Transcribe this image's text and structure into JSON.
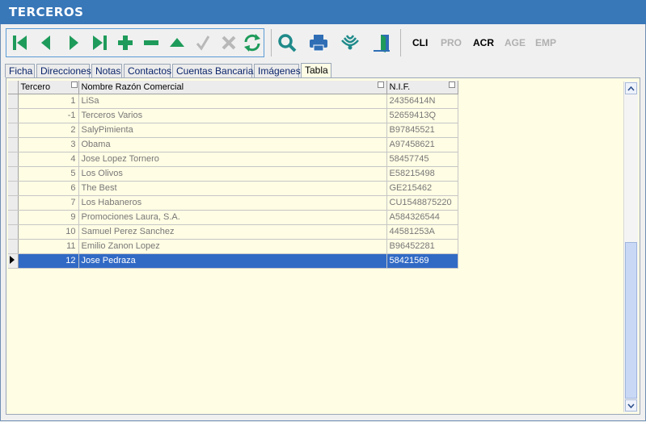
{
  "window": {
    "title": "TERCEROS"
  },
  "toolbar": {
    "nav_icons": [
      "first-record-icon",
      "prev-record-icon",
      "next-record-icon",
      "last-record-icon",
      "add-icon",
      "delete-icon",
      "edit-icon",
      "confirm-icon",
      "cancel-icon",
      "refresh-icon"
    ],
    "tool_icons": [
      "search-icon",
      "print-icon",
      "signal-icon",
      "exit-icon"
    ],
    "text_buttons": [
      {
        "label": "CLI",
        "enabled": true
      },
      {
        "label": "PRO",
        "enabled": false
      },
      {
        "label": "ACR",
        "enabled": true
      },
      {
        "label": "AGE",
        "enabled": false
      },
      {
        "label": "EMP",
        "enabled": false
      }
    ],
    "colors": {
      "nav": "#1e9b5a",
      "disabled": "#b8b8b8",
      "search": "#1f8a8a",
      "print": "#2f6eb5"
    }
  },
  "tabs": [
    {
      "label": "Ficha"
    },
    {
      "label": "Direcciones"
    },
    {
      "label": "Notas"
    },
    {
      "label": "Contactos"
    },
    {
      "label": "Cuentas Bancarias"
    },
    {
      "label": "Imágenes"
    },
    {
      "label": "Tabla",
      "active": true
    }
  ],
  "grid": {
    "columns": [
      "Tercero",
      "Nombre Razón Comercial",
      "N.I.F."
    ],
    "rows": [
      {
        "id": "1",
        "name": "LiSa",
        "nif": "24356414N"
      },
      {
        "id": "-1",
        "name": "Terceros Varios",
        "nif": "52659413Q"
      },
      {
        "id": "2",
        "name": "SalyPimienta",
        "nif": "B97845521"
      },
      {
        "id": "3",
        "name": "Obama",
        "nif": "A97458621"
      },
      {
        "id": "4",
        "name": "Jose Lopez Tornero",
        "nif": "58457745"
      },
      {
        "id": "5",
        "name": "Los Olivos",
        "nif": "E58215498"
      },
      {
        "id": "6",
        "name": "The Best",
        "nif": "GE215462"
      },
      {
        "id": "7",
        "name": "Los Habaneros",
        "nif": "CU1548875220"
      },
      {
        "id": "9",
        "name": "Promociones Laura, S.A.",
        "nif": "A584326544"
      },
      {
        "id": "10",
        "name": "Samuel Perez Sanchez",
        "nif": "44581253A"
      },
      {
        "id": "11",
        "name": "Emilio Zanon Lopez",
        "nif": "B96452281"
      },
      {
        "id": "12",
        "name": "Jose Pedraza",
        "nif": "58421569",
        "selected": true
      }
    ]
  }
}
